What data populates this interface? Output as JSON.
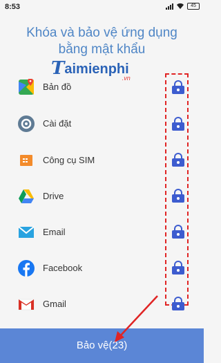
{
  "status": {
    "time": "8:53",
    "battery": "45"
  },
  "header": {
    "line1": "Khóa và bảo vệ ứng dụng",
    "line2": "bằng mật khẩu"
  },
  "watermark": {
    "main": "aimienphi",
    "sub": ".vn"
  },
  "apps": [
    {
      "label": "Bản đồ",
      "icon": "maps-icon",
      "locked": true
    },
    {
      "label": "Cài đặt",
      "icon": "settings-icon",
      "locked": true
    },
    {
      "label": "Công cụ SIM",
      "icon": "sim-toolkit-icon",
      "locked": true
    },
    {
      "label": "Drive",
      "icon": "drive-icon",
      "locked": true
    },
    {
      "label": "Email",
      "icon": "email-icon",
      "locked": true
    },
    {
      "label": "Facebook",
      "icon": "facebook-icon",
      "locked": true
    },
    {
      "label": "Gmail",
      "icon": "gmail-icon",
      "locked": true
    }
  ],
  "bottom": {
    "label": "Bảo vệ(23)"
  },
  "colors": {
    "accent": "#5b86d6",
    "lock": "#3d5ccf",
    "highlight": "#e02424",
    "heading": "#4f86c6"
  }
}
